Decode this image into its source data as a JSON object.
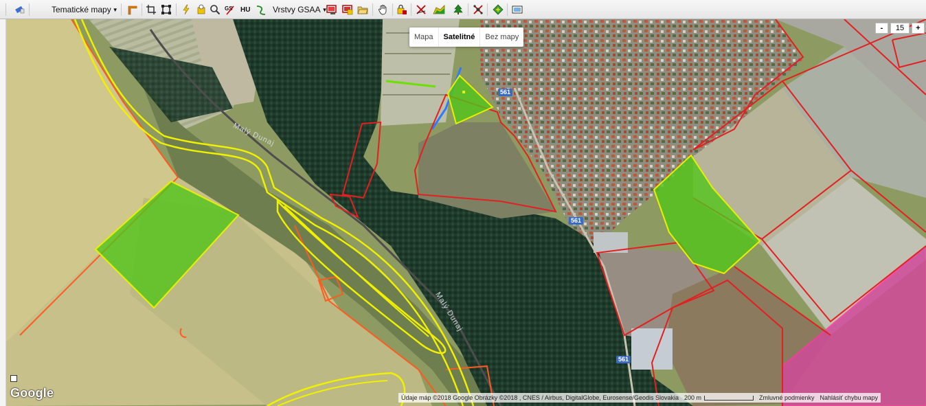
{
  "toolbar": {
    "tematicke_label": "Tematické mapy",
    "hu_label": "HU",
    "vrstvy_label": "Vrstvy GSAA"
  },
  "map_type": {
    "options": [
      "Mapa",
      "Satelitné",
      "Bez mapy"
    ],
    "selected": "Satelitné"
  },
  "zoom": {
    "minus": "-",
    "level": "15",
    "plus": "+"
  },
  "labels": {
    "road_561_a": "561",
    "road_561_b": "561",
    "road_561_c": "561",
    "river_a": "Malý Dunaj",
    "river_b": "Malý Dunaj"
  },
  "footer": {
    "google_logo": "Google",
    "attribution": "Údaje máp ©2018 Google Obrázky ©2018 , CNES / Airbus, DigitalGlobe, Eurosense/Geodis Slovakia",
    "scale": "200 m",
    "terms": "Zmluvné podmienky",
    "report": "Nahlásiť chybu mapy"
  },
  "colors": {
    "parcel_selected_fill": "#52c41a",
    "parcel_selected_outline": "#e8f000",
    "parcel_outline": "#e32020",
    "parcel_outline_orange": "#ff5a1e",
    "pink_parcel": "#d04a9a",
    "river_outline": "#f0f000"
  }
}
